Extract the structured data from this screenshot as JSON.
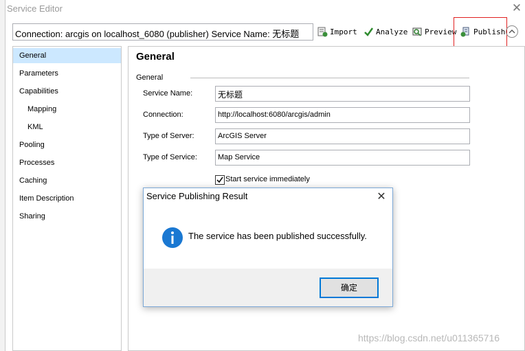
{
  "window": {
    "title": "Service Editor",
    "close_glyph": "✕"
  },
  "toolbar": {
    "connection_text": "Connection: arcgis on localhost_6080 (publisher)    Service Name: 无标题",
    "import_label": "Import",
    "analyze_label": "Analyze",
    "preview_label": "Preview",
    "publish_label": "Publish"
  },
  "sidebar": {
    "items": [
      {
        "label": "General"
      },
      {
        "label": "Parameters"
      },
      {
        "label": "Capabilities"
      },
      {
        "label": "Mapping"
      },
      {
        "label": "KML"
      },
      {
        "label": "Pooling"
      },
      {
        "label": "Processes"
      },
      {
        "label": "Caching"
      },
      {
        "label": "Item Description"
      },
      {
        "label": "Sharing"
      }
    ]
  },
  "main": {
    "title": "General",
    "group_label": "General",
    "fields": [
      {
        "label": "Service Name:",
        "value": "无标题"
      },
      {
        "label": "Connection:",
        "value": "http://localhost:6080/arcgis/admin"
      },
      {
        "label": "Type of Server:",
        "value": "ArcGIS Server"
      },
      {
        "label": "Type of Service:",
        "value": "Map Service"
      }
    ],
    "start_checkbox_label": "Start service immediately",
    "start_checkbox_checked": true
  },
  "dialog": {
    "title": "Service Publishing Result",
    "message": "The service has been published successfully.",
    "ok_label": "确定",
    "close_glyph": "✕"
  },
  "watermark": "https://blog.csdn.net/u011365716",
  "colors": {
    "nav_selected": "#cce8ff",
    "highlight_border": "#e02020",
    "info_icon": "#1a78d2",
    "button_border": "#0078d7"
  },
  "icons": [
    "import-icon",
    "analyze-check-icon",
    "preview-icon",
    "publish-icon",
    "collapse-up-icon",
    "info-icon",
    "close-icon"
  ]
}
